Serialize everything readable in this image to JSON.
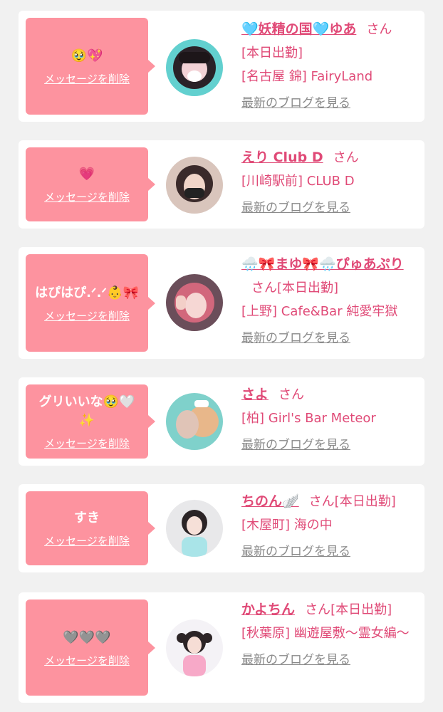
{
  "delete_label": "メッセージを削除",
  "blog_label": "最新のブログを見る",
  "suffix": "さん",
  "colors": {
    "bubble": "#fd939f",
    "name": "#e04a77",
    "link_gray": "#8a8a8a"
  },
  "items": [
    {
      "message": "🥹💖",
      "name": "🩵妖精の国🩵ゆあ",
      "status": "",
      "lines": [
        "[本日出勤]",
        "[名古屋 錦] FairyLand"
      ]
    },
    {
      "message": "💗",
      "name": "えり Club D",
      "status": "",
      "lines": [
        "[川崎駅前] CLUB D"
      ]
    },
    {
      "message": "はぴはぴ.ᐟ.ᐟ👶🎀",
      "name": "🌧️🎀まゆ🎀🌧️ぴゅあぷり",
      "status": "[本日出勤]",
      "lines": [
        "[上野] Cafe&Bar 純愛牢獄"
      ]
    },
    {
      "message": "グリいいな🥹🤍✨",
      "name": "さよ",
      "status": "",
      "lines": [
        "[柏] Girl's Bar Meteor"
      ]
    },
    {
      "message": "すき",
      "name": "ちのん🪽",
      "status": "[本日出勤]",
      "lines": [
        "[木屋町] 海の中"
      ]
    },
    {
      "message": "🩶🩶🩶",
      "name": "かよちん",
      "status": "[本日出勤]",
      "lines": [
        "[秋葉原] 幽遊屋敷〜霊女編〜"
      ]
    }
  ]
}
